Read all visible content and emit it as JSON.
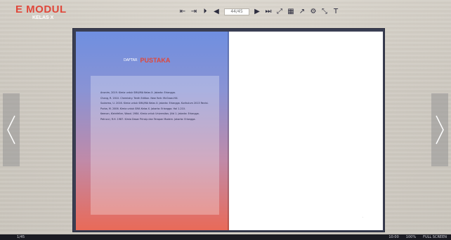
{
  "app": {
    "logo_text": "E MODUL",
    "logo_sub": "KELAS X"
  },
  "toolbar": {
    "buttons": [
      {
        "name": "first-page-button",
        "glyph": "⇤"
      },
      {
        "name": "prev-page-button",
        "glyph": "⇥"
      },
      {
        "name": "play-button",
        "glyph": "⏵"
      },
      {
        "name": "back-button",
        "glyph": "◀"
      },
      {
        "name": "forward-button",
        "glyph": "▶"
      },
      {
        "name": "next-button",
        "glyph": "⏭"
      },
      {
        "name": "zoom-button",
        "glyph": "⤢"
      },
      {
        "name": "thumbnails-button",
        "glyph": "▦"
      },
      {
        "name": "share-button",
        "glyph": "↗"
      },
      {
        "name": "settings-button",
        "glyph": "⚙"
      },
      {
        "name": "fullscreen-button",
        "glyph": "⤡"
      },
      {
        "name": "text-button",
        "glyph": "T"
      }
    ],
    "page_value": "44/45"
  },
  "book": {
    "title_prefix": "DAFTAR",
    "title": "PUSTAKA",
    "references": [
      "Anonim, 2019. Kimia untuk SMA/MA Kelas X. Jakarta: Erlangga.",
      "Chang, R. 2010. Chemistry. Tenth Edition. New York: McGraw-Hill.",
      "Sudarmo, U. 2016. Kimia untuk SMA/MA Kelas X. Jakarta: Erlangga. Kurikulum 2013 Revisi.",
      "Purba, M. 2006. Kimia untuk SMA Kelas X. Jakarta: Erlangga. Hal 1-210.",
      "Keenan, Kleinfelter, Wood. 1984. Kimia untuk Universitas. Jilid 1. Jakarta: Erlangga.",
      "Petrucci, R.H. 1987. Kimia Dasar Prinsip dan Terapan Modern. Jakarta: Erlangga."
    ]
  },
  "status": {
    "left": "1/45",
    "right_items": [
      "10:00",
      "100%",
      "FULL SCREEN"
    ]
  }
}
